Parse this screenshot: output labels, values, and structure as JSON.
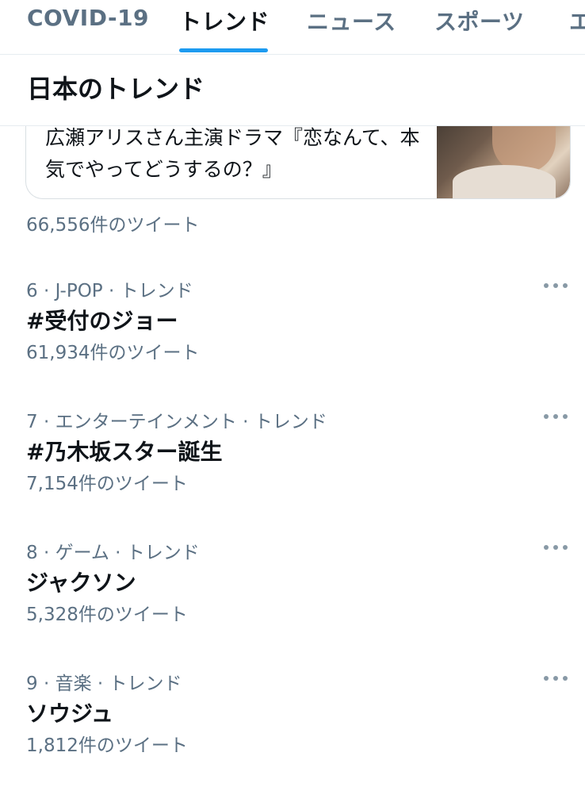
{
  "tabs": [
    {
      "label": "COVID-19"
    },
    {
      "label": "トレンド"
    },
    {
      "label": "ニュース"
    },
    {
      "label": "スポーツ"
    },
    {
      "label": "エ"
    }
  ],
  "active_tab": "トレンド",
  "section_title": "日本のトレンド",
  "card": {
    "text": "広瀬アリスさん主演ドラマ『恋なんて、本気でやってどうするの？』"
  },
  "first_count": "66,556件のツイート",
  "trends": [
    {
      "meta": "6 · J-POP · トレンド",
      "name": "#受付のジョー",
      "count": "61,934件のツイート"
    },
    {
      "meta": "7 · エンターテインメント · トレンド",
      "name": "#乃木坂スター誕生",
      "count": "7,154件のツイート"
    },
    {
      "meta": "8 · ゲーム · トレンド",
      "name": "ジャクソン",
      "count": "5,328件のツイート"
    },
    {
      "meta": "9 · 音楽 · トレンド",
      "name": "ソウジュ",
      "count": "1,812件のツイート"
    }
  ],
  "colors": {
    "accent": "#1d9bf0",
    "secondary_text": "#5b7083",
    "primary_text": "#0f1419"
  },
  "icons": {
    "more": "more-horizontal-icon"
  }
}
